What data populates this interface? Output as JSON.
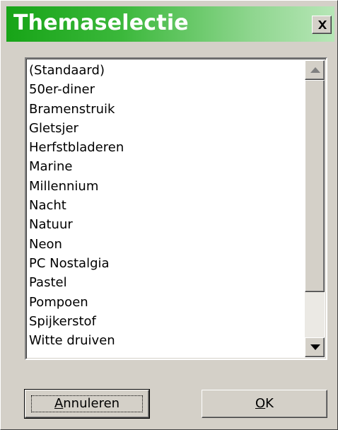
{
  "dialog": {
    "title": "Themaselectie",
    "close_icon": "close-icon"
  },
  "themes": {
    "items": [
      "(Standaard)",
      "50er-diner",
      "Bramenstruik",
      "Gletsjer",
      "Herfstbladeren",
      "Marine",
      "Millennium",
      "Nacht",
      "Natuur",
      "Neon",
      "PC Nostalgia",
      "Pastel",
      "Pompoen",
      "Spijkerstof",
      "Witte druiven"
    ]
  },
  "scrollbar": {
    "up_icon": "arrow-up-icon",
    "down_icon": "arrow-down-icon"
  },
  "buttons": {
    "cancel": {
      "mnemonic": "A",
      "rest": "nnuleren"
    },
    "ok": {
      "mnemonic": "O",
      "rest": "K"
    }
  },
  "colors": {
    "titlebar_start": "#17a417",
    "titlebar_end": "#b7e6b7",
    "face": "#d4d0c8"
  }
}
